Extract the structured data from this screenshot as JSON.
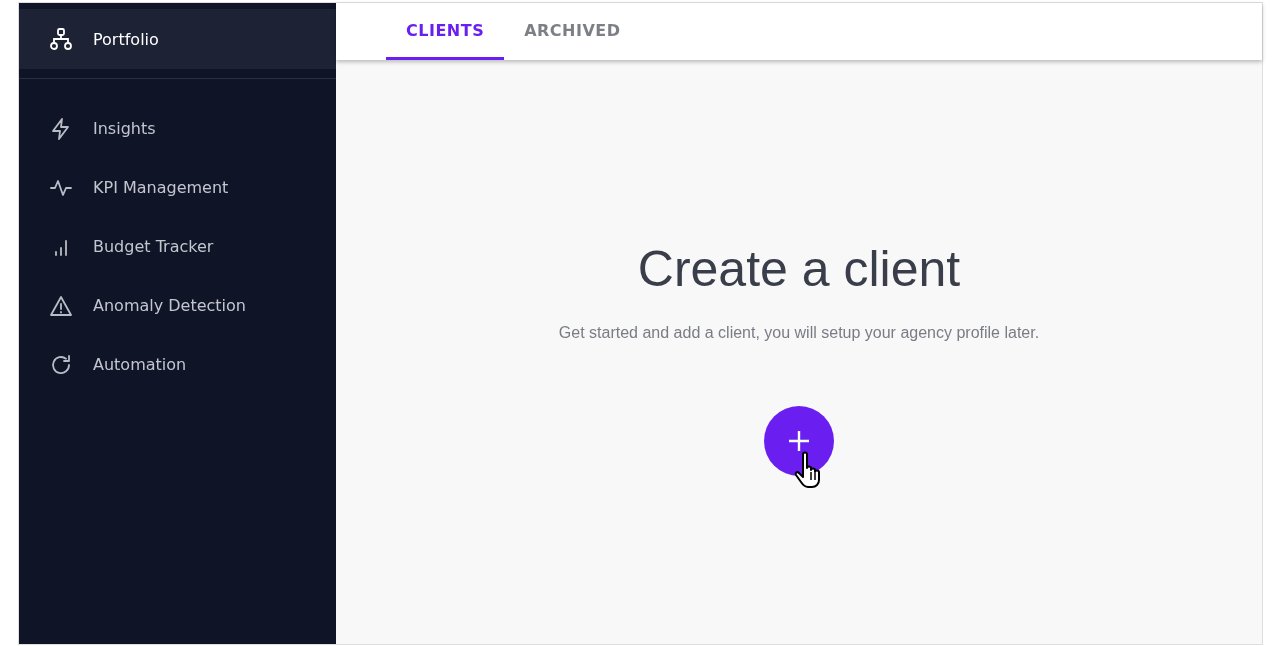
{
  "sidebar": {
    "header": {
      "label": "Portfolio",
      "selected": true
    },
    "items": [
      {
        "label": "Insights",
        "selected": false
      },
      {
        "label": "KPI Management",
        "selected": false
      },
      {
        "label": "Budget Tracker",
        "selected": false
      },
      {
        "label": "Anomaly Detection",
        "selected": false
      },
      {
        "label": "Automation",
        "selected": false
      }
    ]
  },
  "tabs": [
    {
      "label": "CLIENTS",
      "selected": true
    },
    {
      "label": "ARCHIVED",
      "selected": false
    }
  ],
  "empty_state": {
    "title": "Create a client",
    "subtitle": "Get started and add a client, you will setup your agency profile later."
  }
}
